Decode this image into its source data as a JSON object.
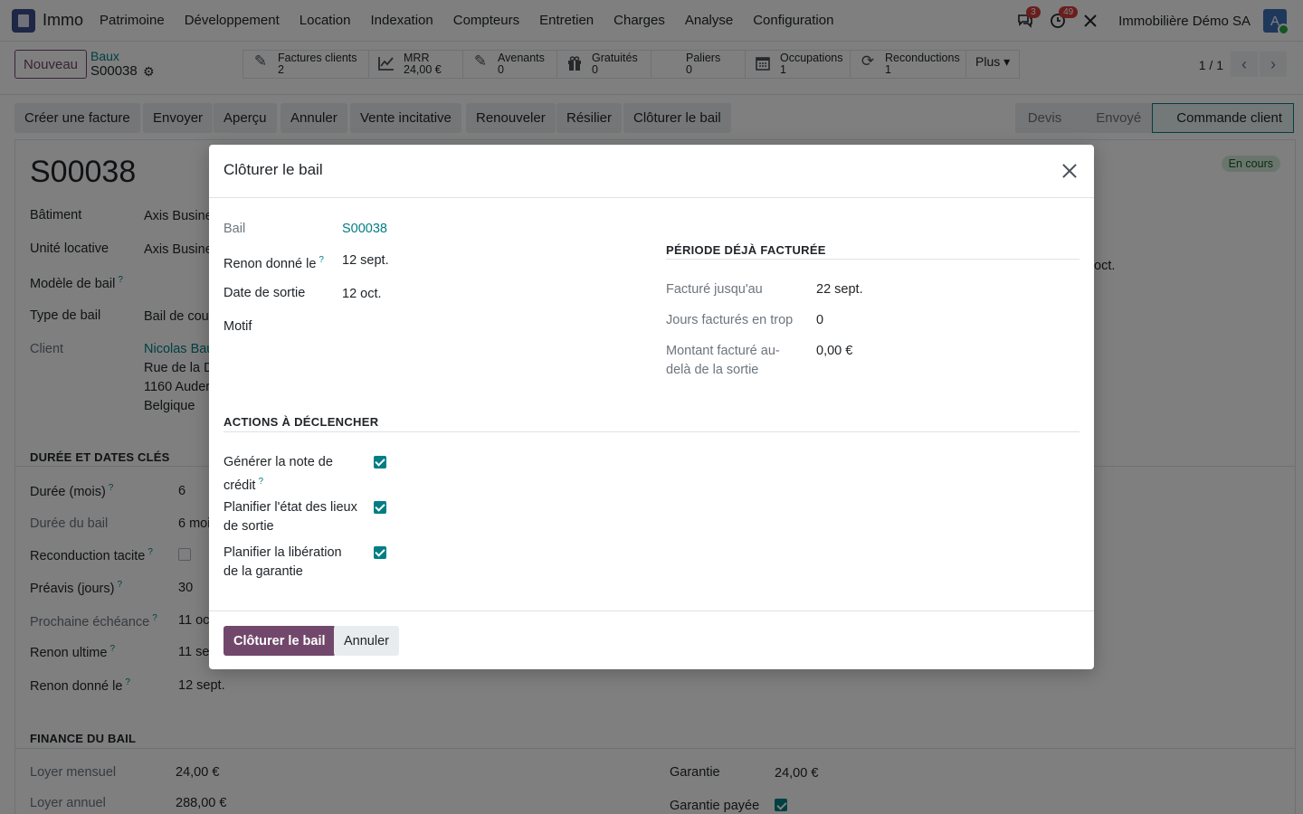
{
  "navbar": {
    "app_name": "Immo",
    "menu": [
      "Patrimoine",
      "Développement",
      "Location",
      "Indexation",
      "Compteurs",
      "Entretien",
      "Charges",
      "Analyse",
      "Configuration"
    ],
    "messages_count": "3",
    "activities_count": "49",
    "company": "Immobilière Démo SA",
    "avatar_letter": "A"
  },
  "control_panel": {
    "new_button": "Nouveau",
    "breadcrumb_parent": "Baux",
    "breadcrumb_current": "S00038",
    "smart_buttons": [
      {
        "label": "Factures clients",
        "value": "2",
        "icon": "pencil-square-icon"
      },
      {
        "label": "MRR",
        "value": "24,00 €",
        "icon": "line-chart-icon"
      },
      {
        "label": "Avenants",
        "value": "0",
        "icon": "pencil-square-icon"
      },
      {
        "label": "Gratuités",
        "value": "0",
        "icon": "gift-icon"
      },
      {
        "label": "Paliers",
        "value": "0",
        "icon": ""
      },
      {
        "label": "Occupations",
        "value": "1",
        "icon": "calendar-icon"
      },
      {
        "label": "Reconductions",
        "value": "1",
        "icon": "refresh-icon"
      }
    ],
    "more_button": "Plus",
    "pager": "1 / 1"
  },
  "header_actions": [
    "Créer une facture",
    "Envoyer",
    "Aperçu",
    "Annuler",
    "Vente incitative",
    "Renouveler",
    "Résilier",
    "Clôturer le bail"
  ],
  "status_steps": [
    "Devis",
    "Envoyé",
    "Commande client"
  ],
  "record": {
    "title": "S00038",
    "state_badge": "En cours",
    "fields_left": [
      {
        "label": "Bâtiment",
        "value": "Axis Busine"
      },
      {
        "label": "Unité locative",
        "value": "Axis Busine"
      },
      {
        "label": "Modèle de bail",
        "value": ""
      },
      {
        "label": "Type de bail",
        "value": "Bail de cou"
      },
      {
        "label": "Client",
        "value": "Nicolas Bau"
      }
    ],
    "client_address": [
      "Rue de la D",
      "1160 Auder",
      "Belgique"
    ],
    "right_partial_text": "oct.",
    "section_dates": "DURÉE ET DATES CLÉS",
    "dates_fields": [
      {
        "label": "Durée (mois)",
        "value": "6"
      },
      {
        "label": "Durée du bail",
        "value": "6 moi"
      },
      {
        "label": "Reconduction tacite",
        "value": ""
      },
      {
        "label": "Préavis (jours)",
        "value": "30"
      },
      {
        "label": "Prochaine échéance",
        "value": "11 oct"
      },
      {
        "label": "Renon ultime",
        "value": "11 sep"
      },
      {
        "label": "Renon donné le",
        "value": "12 sept."
      }
    ],
    "section_finance": "FINANCE DU BAIL",
    "finance_left": [
      {
        "label": "Loyer mensuel",
        "value": "24,00 €"
      },
      {
        "label": "Loyer annuel",
        "value": "288,00 €"
      }
    ],
    "finance_right": [
      {
        "label": "Garantie",
        "value": "24,00 €"
      },
      {
        "label": "Garantie payée",
        "value": ""
      }
    ]
  },
  "dialog": {
    "title": "Clôturer le bail",
    "fields": {
      "bail_label": "Bail",
      "bail_value": "S00038",
      "renon_label": "Renon donné le",
      "renon_value": "12 sept.",
      "sortie_label": "Date de sortie",
      "sortie_value": "12 oct.",
      "motif_label": "Motif"
    },
    "billing_section": {
      "title": "PÉRIODE DÉJÀ FACTURÉE",
      "billed_until_label": "Facturé jusqu'au",
      "billed_until_value": "22 sept.",
      "extra_days_label": "Jours facturés en trop",
      "extra_days_value": "0",
      "extra_amount_label": "Montant facturé au-delà de la sortie",
      "extra_amount_value": "0,00 €"
    },
    "actions_section": {
      "title": "ACTIONS À DÉCLENCHER",
      "items": [
        {
          "label": "Générer la note de crédit",
          "checked": true
        },
        {
          "label": "Planifier l'état des lieux de sortie",
          "checked": true
        },
        {
          "label": "Planifier la libération de la garantie",
          "checked": true
        }
      ]
    },
    "confirm_button": "Clôturer le bail",
    "cancel_button": "Annuler"
  },
  "colors": {
    "primary": "#71486b",
    "link": "#017e84",
    "success_badge": "#d4edda"
  }
}
